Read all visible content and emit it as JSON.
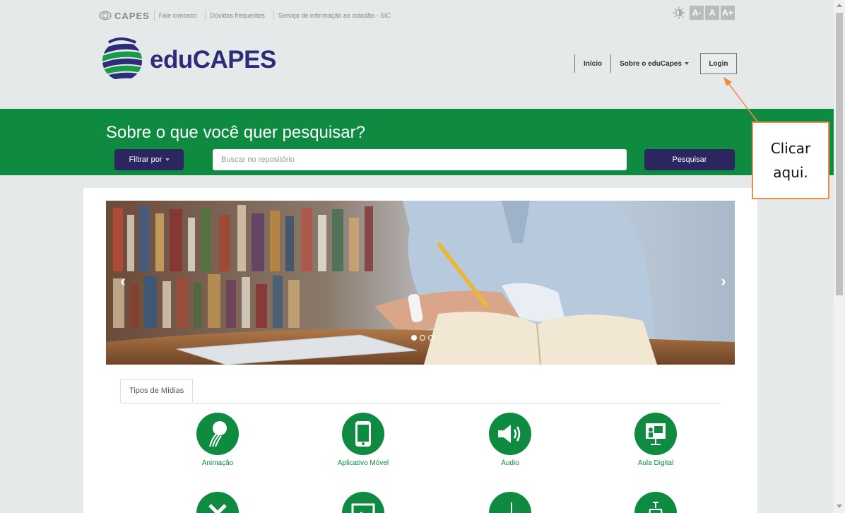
{
  "topbar": {
    "capes_logo": "CAPES",
    "links": [
      "Fale conosco",
      "Dúvidas frequentes",
      "Serviço de informação ao cidadão - SIC"
    ],
    "font_buttons": [
      "A-",
      "A",
      "A+"
    ]
  },
  "header": {
    "brand": "eduCAPES",
    "nav": {
      "home": "Início",
      "about": "Sobre o eduCapes",
      "login": "Login"
    }
  },
  "search": {
    "title": "Sobre o que você quer pesquisar?",
    "filter_label": "Filtrar por",
    "placeholder": "Buscar no repositório",
    "button_label": "Pesquisar"
  },
  "tabs": {
    "media_types": "Tipos de Mídias"
  },
  "media": [
    {
      "label": "Animação",
      "icon": "animation-icon"
    },
    {
      "label": "Aplicativo Móvel",
      "icon": "mobile-app-icon"
    },
    {
      "label": "Áudio",
      "icon": "audio-icon"
    },
    {
      "label": "Aula Digital",
      "icon": "digital-class-icon"
    }
  ],
  "callout": {
    "line1": "Clicar",
    "line2": "aqui."
  },
  "colors": {
    "green": "#0e8b41",
    "navy": "#2b2660",
    "orange": "#ee8d45"
  }
}
